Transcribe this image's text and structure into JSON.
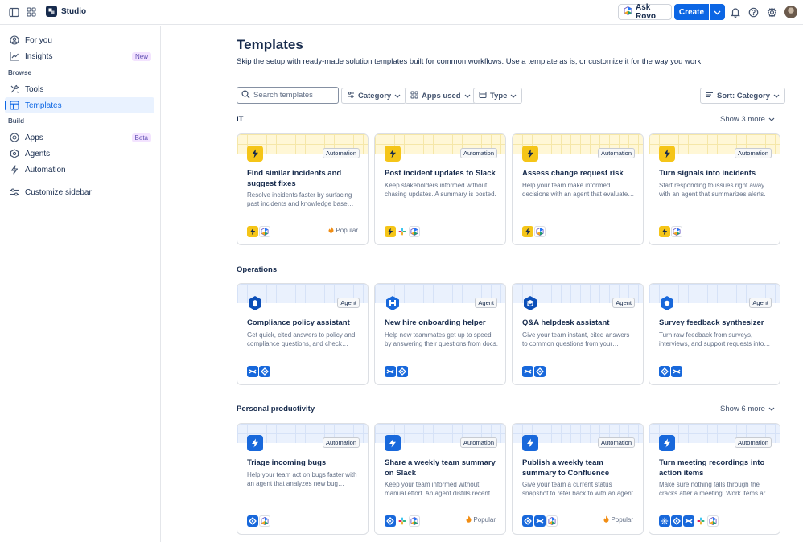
{
  "topbar": {
    "app_name": "Studio",
    "ask_rovo": "Ask Rovo",
    "create": "Create"
  },
  "sidebar": {
    "items": [
      {
        "label": "For you",
        "icon": "user-circle-icon"
      },
      {
        "label": "Insights",
        "icon": "chart-line-icon",
        "badge": "New"
      },
      {
        "label": "Tools",
        "icon": "tools-icon"
      },
      {
        "label": "Templates",
        "icon": "template-icon",
        "active": true
      },
      {
        "label": "Apps",
        "icon": "apps-icon",
        "badge": "Beta"
      },
      {
        "label": "Agents",
        "icon": "agent-icon"
      },
      {
        "label": "Automation",
        "icon": "lightning-icon"
      },
      {
        "label": "Customize sidebar",
        "icon": "customize-icon"
      }
    ],
    "sections": {
      "browse": "Browse",
      "build": "Build"
    }
  },
  "main": {
    "title": "Templates",
    "description": "Skip the setup with ready-made solution templates built for common workflows. Use a template as is, or customize it for the way you work.",
    "search_placeholder": "Search templates",
    "filters": [
      "Category",
      "Apps used",
      "Type"
    ],
    "sort": "Sort: Category"
  },
  "sections": [
    {
      "title": "IT",
      "show_more": "Show 3 more",
      "cards": [
        {
          "tag": "Automation",
          "title": "Find similar incidents and suggest fixes",
          "desc": "Resolve incidents faster by surfacing past incidents and knowledge base articles.",
          "popular": "Popular"
        },
        {
          "tag": "Automation",
          "title": "Post incident updates to Slack",
          "desc": "Keep stakeholders informed without chasing updates. A summary is posted."
        },
        {
          "tag": "Automation",
          "title": "Assess change request risk",
          "desc": "Help your team make informed decisions with an agent that evaluates risk."
        },
        {
          "tag": "Automation",
          "title": "Turn signals into incidents",
          "desc": "Start responding to issues right away with an agent that summarizes alerts."
        }
      ]
    },
    {
      "title": "Operations",
      "show_more": "",
      "cards": [
        {
          "tag": "Agent",
          "title": "Compliance policy assistant",
          "desc": "Get quick, cited answers to policy and compliance questions, and check requirements."
        },
        {
          "tag": "Agent",
          "title": "New hire onboarding helper",
          "desc": "Help new teammates get up to speed by answering their questions from docs."
        },
        {
          "tag": "Agent",
          "title": "Q&A helpdesk assistant",
          "desc": "Give your team instant, cited answers to common questions from your knowledge base."
        },
        {
          "tag": "Agent",
          "title": "Survey feedback synthesizer",
          "desc": "Turn raw feedback from surveys, interviews, and support requests into insights."
        }
      ]
    },
    {
      "title": "Personal productivity",
      "show_more": "Show 6 more",
      "cards": [
        {
          "tag": "Automation",
          "title": "Triage incoming bugs",
          "desc": "Help your team act on bugs faster with an agent that analyzes new bug reports."
        },
        {
          "tag": "Automation",
          "title": "Share a weekly team summary on Slack",
          "desc": "Keep your team informed without manual effort. An agent distills recent work.",
          "popular": "Popular"
        },
        {
          "tag": "Automation",
          "title": "Publish a weekly team summary to Confluence",
          "desc": "Give your team a current status snapshot to refer back to with an agent.",
          "popular": "Popular"
        },
        {
          "tag": "Automation",
          "title": "Turn meeting recordings into action items",
          "desc": "Make sure nothing falls through the cracks after a meeting. Work items are created."
        }
      ]
    }
  ],
  "colors": {
    "accent": "#0c66e4",
    "automation_icon": "#f5c518",
    "agent_icon": "#1868db"
  }
}
